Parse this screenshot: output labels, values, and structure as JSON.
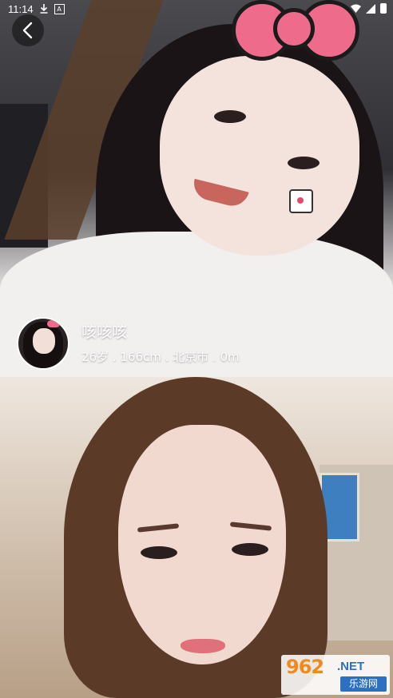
{
  "status_bar": {
    "time": "11:14",
    "icons": [
      "download-icon",
      "a-icon",
      "wifi-icon",
      "signal-icon",
      "battery-icon"
    ]
  },
  "navigation": {
    "back_icon": "chevron-left-icon"
  },
  "profile": {
    "name": "咳咳咳",
    "details": "26岁 . 166cm . 北京市 . 0m"
  },
  "photos": [
    {
      "name": "photo-1"
    },
    {
      "name": "photo-2"
    }
  ],
  "watermark": {
    "number": "962",
    "domain": ".NET",
    "chinese": "乐游网"
  },
  "colors": {
    "bow_pink": "#ef6b8c",
    "watermark_orange": "#f08a1c",
    "watermark_blue": "#2d6fc0"
  }
}
